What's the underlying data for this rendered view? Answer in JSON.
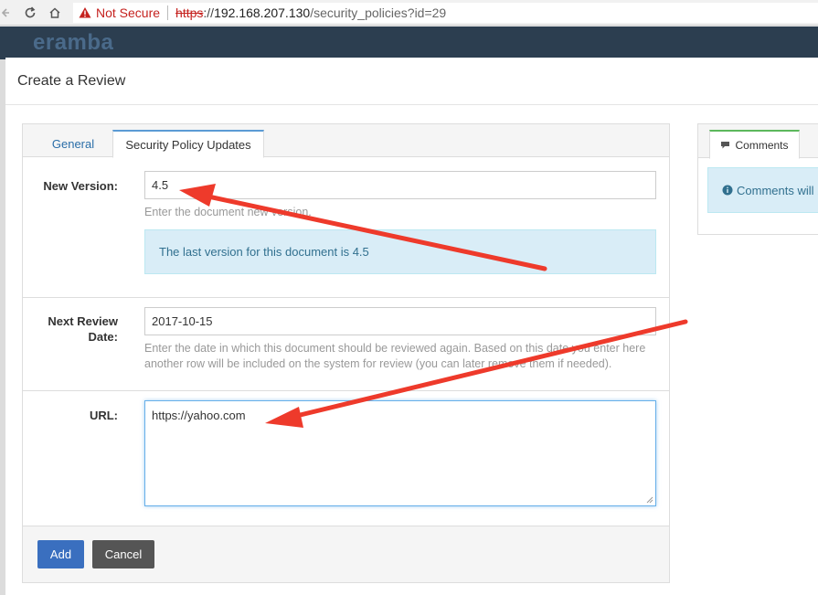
{
  "browser": {
    "security_label": "Not Secure",
    "url_protocol": "https",
    "url_protocol_rest": "://",
    "url_host": "192.168.207.130",
    "url_path": "/security_policies?id=29"
  },
  "app": {
    "logo_text": "eramba"
  },
  "modal": {
    "title": "Create a Review",
    "tabs": [
      {
        "label": "General",
        "active": false
      },
      {
        "label": "Security Policy Updates",
        "active": true
      }
    ],
    "fields": {
      "new_version": {
        "label": "New Version:",
        "value": "4.5",
        "help": "Enter the document new version.",
        "info": "The last version for this document is 4.5"
      },
      "next_review_date": {
        "label_line1": "Next Review",
        "label_line2": "Date:",
        "value": "2017-10-15",
        "help": "Enter the date in which this document should be reviewed again. Based on this date you enter here another row will be included on the system for review (you can later remove them if needed)."
      },
      "url": {
        "label": "URL:",
        "value": "https://yahoo.com"
      }
    },
    "buttons": {
      "add": "Add",
      "cancel": "Cancel"
    }
  },
  "comments": {
    "tab_label": "Comments",
    "info_text": "Comments will b"
  },
  "colors": {
    "annotation_arrow": "#ee3a2b",
    "primary_button": "#3a6fbf",
    "info_background": "#d9edf7",
    "header_dark": "#2c3e50"
  }
}
